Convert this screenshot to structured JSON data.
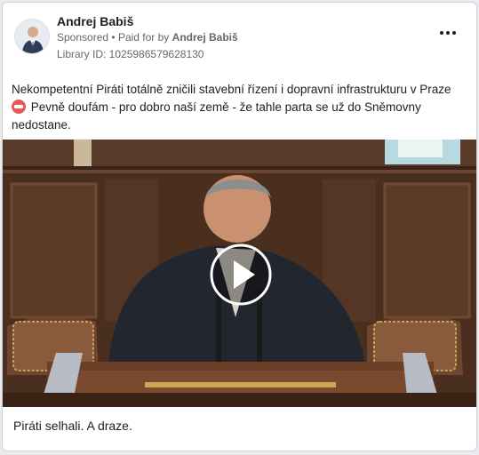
{
  "post": {
    "author": "Andrej Babiš",
    "sponsored_label": "Sponsored",
    "paid_prefix": "Paid for by",
    "paid_by": "Andrej Babiš",
    "library_id": "Library ID: 1025986579628130",
    "text_line1": "Nekompetentní Piráti totálně zničili stavební řízení i dopravní infrastrukturu v Praze",
    "text_line2": "Pevně doufám - pro dobro naší země - že tahle parta se už do Sněmovny nedostane.",
    "badge_icon": "no-entry-emoji-icon",
    "caption": "Piráti selhali. A draze."
  },
  "colors": {
    "text_primary": "#1c1e21",
    "text_secondary": "#65676b",
    "badge_red": "#e45a5a"
  }
}
